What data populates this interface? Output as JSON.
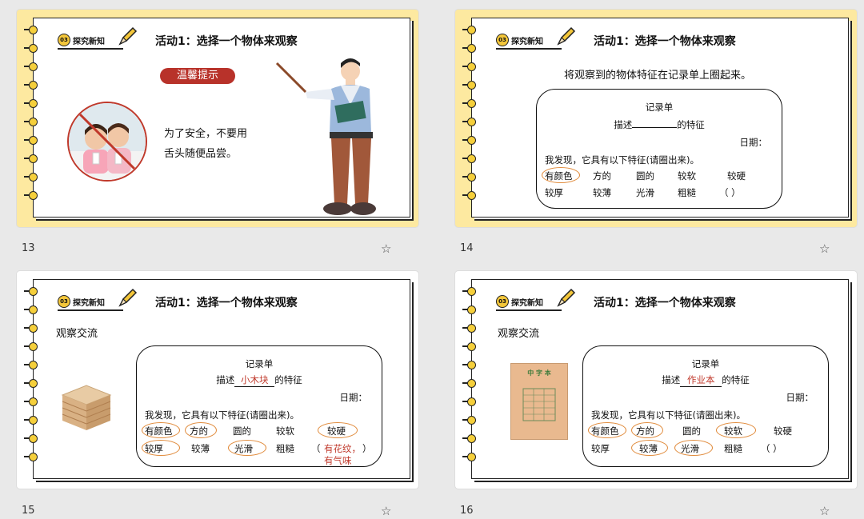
{
  "slides": [
    {
      "number": "13",
      "badge_num": "03",
      "badge_text": "探究新知",
      "title": "活动1：选择一个物体来观察",
      "tip_button": "温馨提示",
      "tip_line1": "为了安全，不要用",
      "tip_line2": "舌头随便品尝。"
    },
    {
      "number": "14",
      "badge_num": "03",
      "badge_text": "探究新知",
      "title": "活动1：选择一个物体来观察",
      "instruction": "将观察到的物体特征在记录单上圈起来。",
      "record": {
        "title": "记录单",
        "describe_prefix": "描述",
        "describe_value": "",
        "describe_suffix": "的特征",
        "date": "日期：",
        "found": "我发现，它具有以下特征(请圈出来)。",
        "row1": [
          "有颜色",
          "方的",
          "圆的",
          "较软",
          "较硬"
        ],
        "row2": [
          "较厚",
          "较薄",
          "光滑",
          "粗糙",
          "（      ）"
        ]
      }
    },
    {
      "number": "15",
      "badge_num": "03",
      "badge_text": "探究新知",
      "title": "活动1：选择一个物体来观察",
      "section": "观察交流",
      "record": {
        "title": "记录单",
        "describe_prefix": "描述",
        "describe_value": "小木块",
        "describe_suffix": "的特征",
        "date": "日期：",
        "found": "我发现，它具有以下特征(请圈出来)。",
        "row1": [
          "有颜色",
          "方的",
          "圆的",
          "较软",
          "较硬"
        ],
        "row2": [
          "较厚",
          "较薄",
          "光滑",
          "粗糙"
        ],
        "extra_open": "（",
        "extra1": "有花纹，",
        "extra2": "有气味",
        "extra_close": "）"
      }
    },
    {
      "number": "16",
      "badge_num": "03",
      "badge_text": "探究新知",
      "title": "活动1：选择一个物体来观察",
      "section": "观察交流",
      "book_title": "中 字 本",
      "record": {
        "title": "记录单",
        "describe_prefix": "描述",
        "describe_value": "作业本",
        "describe_suffix": "的特征",
        "date": "日期：",
        "found": "我发现，它具有以下特征(请圈出来)。",
        "row1": [
          "有颜色",
          "方的",
          "圆的",
          "较软",
          "较硬"
        ],
        "row2": [
          "较厚",
          "较薄",
          "光滑",
          "粗糙",
          "（              ）"
        ]
      }
    }
  ],
  "colors": {
    "yellow_bg": "#fde9a0",
    "tip_red": "#b8322a",
    "oval_orange": "#e08a3a",
    "value_red": "#c0392b"
  }
}
